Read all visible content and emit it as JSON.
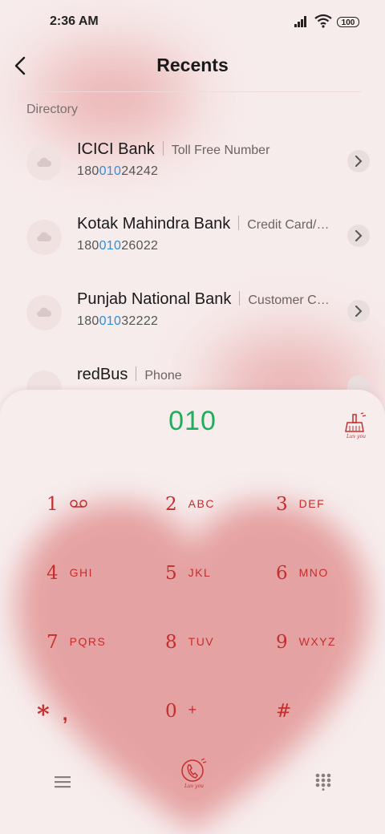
{
  "status_bar": {
    "time": "2:36 AM",
    "battery": "100"
  },
  "header": {
    "title": "Recents"
  },
  "section": {
    "label": "Directory"
  },
  "results": [
    {
      "name": "ICICI Bank",
      "tag": "Toll Free Number",
      "num_pre": "180",
      "num_hl": "010",
      "num_post": "24242"
    },
    {
      "name": "Kotak Mahindra Bank",
      "tag": "Credit Card/…",
      "num_pre": "180",
      "num_hl": "010",
      "num_post": "26022"
    },
    {
      "name": "Punjab National Bank",
      "tag": "Customer C…",
      "num_pre": "180",
      "num_hl": "010",
      "num_post": "32222"
    },
    {
      "name": "redBus",
      "tag": "Phone",
      "num_pre": "",
      "num_hl": "",
      "num_post": ""
    }
  ],
  "dialpad": {
    "typed": "010",
    "keys": [
      {
        "digit": "1",
        "letters": ""
      },
      {
        "digit": "2",
        "letters": "ABC"
      },
      {
        "digit": "3",
        "letters": "DEF"
      },
      {
        "digit": "4",
        "letters": "GHI"
      },
      {
        "digit": "5",
        "letters": "JKL"
      },
      {
        "digit": "6",
        "letters": "MNO"
      },
      {
        "digit": "7",
        "letters": "PQRS"
      },
      {
        "digit": "8",
        "letters": "TUV"
      },
      {
        "digit": "9",
        "letters": "WXYZ"
      },
      {
        "digit": "*",
        "letters": ","
      },
      {
        "digit": "0",
        "letters": "+"
      },
      {
        "digit": "#",
        "letters": ""
      }
    ]
  },
  "icons": {
    "back": "back-arrow-icon",
    "voicemail": "voicemail-icon",
    "clean": "broom-icon",
    "menu": "menu-icon",
    "call": "call-icon",
    "keypad": "keypad-icon"
  },
  "colors": {
    "accent_green": "#1fae5b",
    "key_red": "#c62d2d",
    "highlight_blue": "#2a8fdc"
  }
}
